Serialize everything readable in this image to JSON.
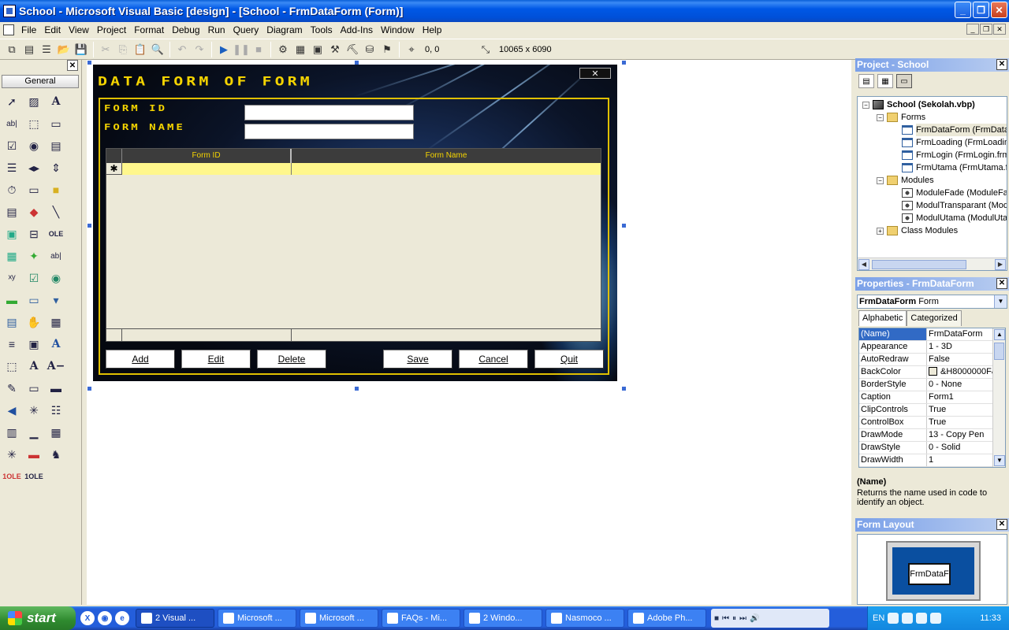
{
  "window": {
    "title": "School - Microsoft Visual Basic [design] - [School - FrmDataForm (Form)]",
    "minimize": "_",
    "restore": "❐",
    "close": "✕"
  },
  "menu": {
    "items": [
      "File",
      "Edit",
      "View",
      "Project",
      "Format",
      "Debug",
      "Run",
      "Query",
      "Diagram",
      "Tools",
      "Add-Ins",
      "Window",
      "Help"
    ]
  },
  "toolbar": {
    "position": "0, 0",
    "size": "10065 x 6090"
  },
  "toolbox": {
    "close": "✕",
    "tab": "General"
  },
  "form": {
    "title": "DATA FORM OF FORM",
    "close_glyph": "✕",
    "label_id": "FORM ID",
    "label_name": "FORM NAME",
    "input_id": "",
    "input_name": "",
    "grid": {
      "columns": [
        "Form ID",
        "Form Name"
      ],
      "new_row_marker": "✱"
    },
    "buttons": [
      "Add",
      "Edit",
      "Delete",
      "Save",
      "Cancel",
      "Quit"
    ]
  },
  "project": {
    "title": "Project - School",
    "close": "✕",
    "tree": [
      {
        "label": "School (Sekolah.vbp)",
        "level": 0,
        "type": "project",
        "expander": "−",
        "bold": true
      },
      {
        "label": "Forms",
        "level": 1,
        "type": "folder",
        "expander": "−"
      },
      {
        "label": "FrmDataForm (FrmDataForm.frm)",
        "level": 2,
        "type": "form",
        "selected": true
      },
      {
        "label": "FrmLoading (FrmLoading.frm)",
        "level": 2,
        "type": "form"
      },
      {
        "label": "FrmLogin (FrmLogin.frm)",
        "level": 2,
        "type": "form"
      },
      {
        "label": "FrmUtama (FrmUtama.frm)",
        "level": 2,
        "type": "form"
      },
      {
        "label": "Modules",
        "level": 1,
        "type": "folder",
        "expander": "−"
      },
      {
        "label": "ModuleFade (ModuleFade.bas)",
        "level": 2,
        "type": "module"
      },
      {
        "label": "ModulTransparant (ModulTransparant.bas)",
        "level": 2,
        "type": "module"
      },
      {
        "label": "ModulUtama (ModulUtama.bas)",
        "level": 2,
        "type": "module"
      },
      {
        "label": "Class Modules",
        "level": 1,
        "type": "folder",
        "expander": "+"
      }
    ]
  },
  "properties": {
    "title": "Properties - FrmDataForm",
    "close": "✕",
    "object_name": "FrmDataForm",
    "object_type": "Form",
    "tabs": [
      "Alphabetic",
      "Categorized"
    ],
    "rows": [
      {
        "name": "(Name)",
        "value": "FrmDataForm",
        "selected": true
      },
      {
        "name": "Appearance",
        "value": "1 - 3D"
      },
      {
        "name": "AutoRedraw",
        "value": "False"
      },
      {
        "name": "BackColor",
        "value": "&H8000000F&",
        "swatch": "#ece9d8"
      },
      {
        "name": "BorderStyle",
        "value": "0 - None"
      },
      {
        "name": "Caption",
        "value": "Form1"
      },
      {
        "name": "ClipControls",
        "value": "True"
      },
      {
        "name": "ControlBox",
        "value": "True"
      },
      {
        "name": "DrawMode",
        "value": "13 - Copy Pen"
      },
      {
        "name": "DrawStyle",
        "value": "0 - Solid"
      },
      {
        "name": "DrawWidth",
        "value": "1"
      }
    ],
    "desc_name": "(Name)",
    "desc_text": "Returns the name used in code to identify an object."
  },
  "layout": {
    "title": "Form Layout",
    "close": "✕",
    "form_label": "FrmDataF"
  },
  "taskbar": {
    "start": "start",
    "tasks": [
      {
        "label": "2 Visual ...",
        "active": true
      },
      {
        "label": "Microsoft ..."
      },
      {
        "label": "Microsoft ..."
      },
      {
        "label": "FAQs - Mi..."
      },
      {
        "label": "2 Windo..."
      },
      {
        "label": "Nasmoco ..."
      },
      {
        "label": "Adobe Ph..."
      }
    ],
    "lang": "EN",
    "clock": "11:33"
  }
}
